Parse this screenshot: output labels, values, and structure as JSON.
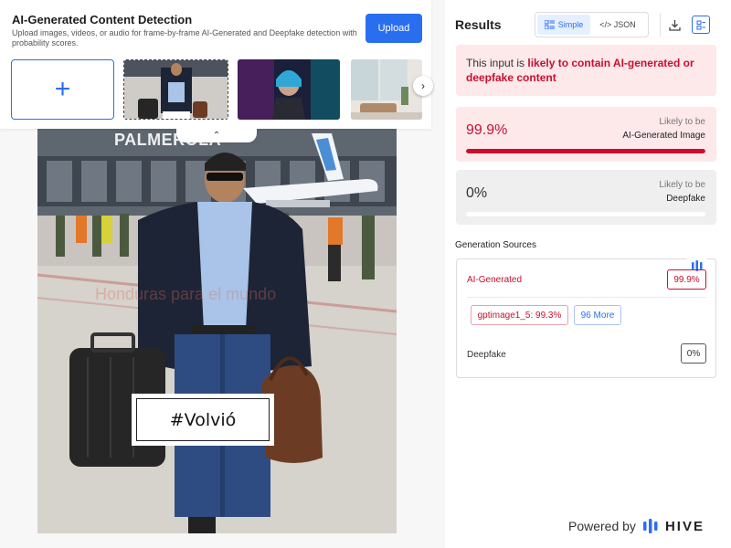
{
  "app": {
    "title": "AI-Generated Content Detection",
    "description": "Upload images, videos, or audio for frame-by-frame AI-Generated and Deepfake detection with probability scores.",
    "upload_label": "Upload"
  },
  "thumbnails": {
    "add_icon": "+",
    "next_icon": "›",
    "collapse_icon": "⌃"
  },
  "image": {
    "sign_text": "PALMEROLA",
    "watermark": "Honduras para el mundo",
    "caption": "#Volvió"
  },
  "results": {
    "title": "Results",
    "view_simple": "Simple",
    "view_json": "</> JSON",
    "alert_prefix": "This input is ",
    "alert_emphasis": "likely to contain AI-generated or deepfake content",
    "ai_card": {
      "value": "99.9%",
      "label_top": "Likely to be",
      "label_bottom": "AI-Generated Image",
      "level": 0.999
    },
    "deepfake_card": {
      "value": "0%",
      "label_top": "Likely to be",
      "label_bottom": "Deepfake",
      "level": 0
    },
    "sources_title": "Generation Sources",
    "sources": {
      "ai_label": "AI-Generated",
      "ai_value": "99.9%",
      "model_chip": "gptimage1_5: 99.3%",
      "more_chip": "96 More",
      "deepfake_label": "Deepfake",
      "deepfake_value": "0%"
    }
  },
  "footer": {
    "powered_by": "Powered by",
    "brand": "HIVE"
  },
  "colors": {
    "accent": "#2a6ef0",
    "danger": "#c8102e",
    "alert_bg": "#fde8ea"
  }
}
